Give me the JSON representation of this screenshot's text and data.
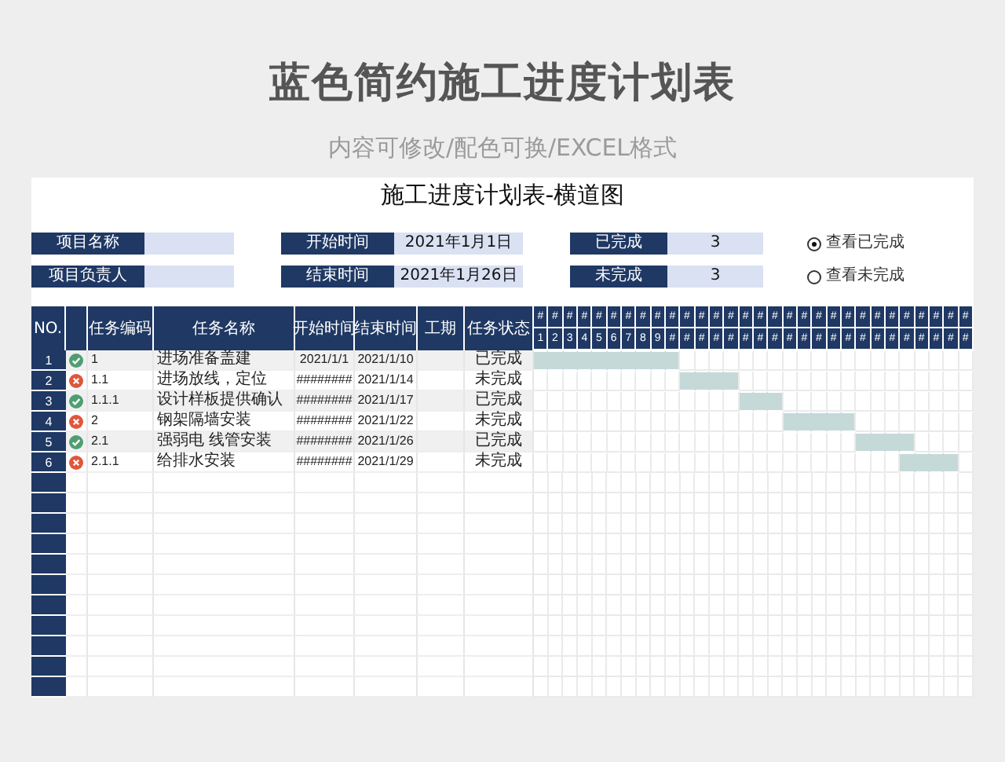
{
  "page_title": "蓝色简约施工进度计划表",
  "page_subtitle": "内容可修改/配色可换/EXCEL格式",
  "sheet": {
    "title": "施工进度计划表-横道图",
    "info_rows": [
      [
        {
          "label": "项目名称"
        },
        {
          "label": "开始时间",
          "value": "2021年1月1日"
        },
        {
          "label": "已完成",
          "value": "3"
        }
      ],
      [
        {
          "label": "项目负责人"
        },
        {
          "label": "结束时间",
          "value": "2021年1月26日"
        },
        {
          "label": "未完成",
          "value": "3"
        }
      ]
    ],
    "view_options": [
      {
        "label": "查看已完成",
        "selected": true
      },
      {
        "label": "查看未完成",
        "selected": false
      }
    ]
  },
  "table": {
    "columns": [
      "NO.",
      "任务编码",
      "任务名称",
      "开始时间",
      "结束时间",
      "工期",
      "任务状态"
    ],
    "timeline": [
      {
        "top": "#",
        "day": "1"
      },
      {
        "top": "#",
        "day": "2"
      },
      {
        "top": "#",
        "day": "3"
      },
      {
        "top": "#",
        "day": "4"
      },
      {
        "top": "#",
        "day": "5"
      },
      {
        "top": "#",
        "day": "6"
      },
      {
        "top": "#",
        "day": "7"
      },
      {
        "top": "#",
        "day": "8"
      },
      {
        "top": "#",
        "day": "9"
      },
      {
        "top": "#",
        "day": "#"
      },
      {
        "top": "#",
        "day": "#"
      },
      {
        "top": "#",
        "day": "#"
      },
      {
        "top": "#",
        "day": "#"
      },
      {
        "top": "#",
        "day": "#"
      },
      {
        "top": "#",
        "day": "#"
      },
      {
        "top": "#",
        "day": "#"
      },
      {
        "top": "#",
        "day": "#"
      },
      {
        "top": "#",
        "day": "#"
      },
      {
        "top": "#",
        "day": "#"
      },
      {
        "top": "#",
        "day": "#"
      },
      {
        "top": "#",
        "day": "#"
      },
      {
        "top": "#",
        "day": "#"
      },
      {
        "top": "#",
        "day": "#"
      },
      {
        "top": "#",
        "day": "#"
      },
      {
        "top": "#",
        "day": "#"
      },
      {
        "top": "#",
        "day": "#"
      },
      {
        "top": "#",
        "day": "#"
      },
      {
        "top": "#",
        "day": "#"
      },
      {
        "top": "#",
        "day": "#"
      },
      {
        "top": "#",
        "day": "#"
      }
    ],
    "rows": [
      {
        "no": "1",
        "completed": true,
        "code": "1",
        "name": "进场准备盖建",
        "start": "2021/1/1",
        "end": "2021/1/10",
        "status": "已完成",
        "days": [
          true,
          true,
          true,
          true,
          true,
          true,
          true,
          true,
          true,
          true,
          false,
          false,
          false,
          false,
          false,
          false,
          false,
          false,
          false,
          false,
          false,
          false,
          false,
          false,
          false,
          false,
          false,
          false,
          false,
          false
        ]
      },
      {
        "no": "2",
        "completed": false,
        "code": "1.1",
        "name": "进场放线，定位",
        "start": "########",
        "end": "2021/1/14",
        "status": "未完成",
        "days": [
          false,
          false,
          false,
          false,
          false,
          false,
          false,
          false,
          false,
          false,
          true,
          true,
          true,
          true,
          false,
          false,
          false,
          false,
          false,
          false,
          false,
          false,
          false,
          false,
          false,
          false,
          false,
          false,
          false,
          false
        ]
      },
      {
        "no": "3",
        "completed": true,
        "code": "1.1.1",
        "name": "设计样板提供确认",
        "start": "########",
        "end": "2021/1/17",
        "status": "已完成",
        "days": [
          false,
          false,
          false,
          false,
          false,
          false,
          false,
          false,
          false,
          false,
          false,
          false,
          false,
          false,
          true,
          true,
          true,
          false,
          false,
          false,
          false,
          false,
          false,
          false,
          false,
          false,
          false,
          false,
          false,
          false
        ]
      },
      {
        "no": "4",
        "completed": false,
        "code": "2",
        "name": "钢架隔墙安装",
        "start": "########",
        "end": "2021/1/22",
        "status": "未完成",
        "days": [
          false,
          false,
          false,
          false,
          false,
          false,
          false,
          false,
          false,
          false,
          false,
          false,
          false,
          false,
          false,
          false,
          false,
          true,
          true,
          true,
          true,
          true,
          false,
          false,
          false,
          false,
          false,
          false,
          false,
          false
        ]
      },
      {
        "no": "5",
        "completed": true,
        "code": "2.1",
        "name": "强弱电 线管安装",
        "start": "########",
        "end": "2021/1/26",
        "status": "已完成",
        "days": [
          false,
          false,
          false,
          false,
          false,
          false,
          false,
          false,
          false,
          false,
          false,
          false,
          false,
          false,
          false,
          false,
          false,
          false,
          false,
          false,
          false,
          false,
          true,
          true,
          true,
          true,
          false,
          false,
          false,
          false
        ]
      },
      {
        "no": "6",
        "completed": false,
        "code": "2.1.1",
        "name": "给排水安装",
        "start": "########",
        "end": "2021/1/29",
        "status": "未完成",
        "days": [
          false,
          false,
          false,
          false,
          false,
          false,
          false,
          false,
          false,
          false,
          false,
          false,
          false,
          false,
          false,
          false,
          false,
          false,
          false,
          false,
          false,
          false,
          false,
          false,
          false,
          true,
          true,
          true,
          true,
          false
        ]
      }
    ]
  }
}
